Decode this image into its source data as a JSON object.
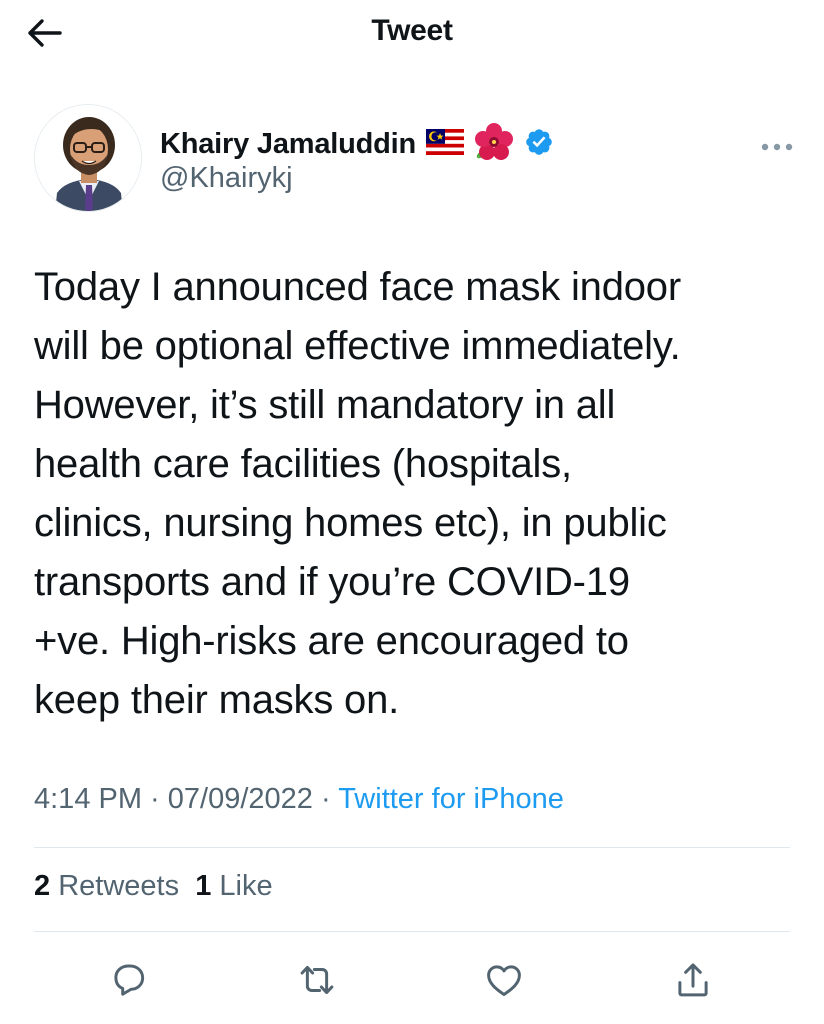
{
  "header": {
    "back_icon": "arrow-left-icon",
    "title": "Tweet"
  },
  "author": {
    "name": "Khairy Jamaluddin",
    "handle": "@Khairykj",
    "badges": [
      "malaysia-flag-icon",
      "hibiscus-icon",
      "verified-badge-icon"
    ],
    "verified_color": "#1d9bf0"
  },
  "tweet": {
    "text": "Today I announced face mask indoor\nwill be optional effective immediately.\nHowever, it’s still mandatory in all\nhealth care facilities (hospitals,\nclinics, nursing homes etc), in public\ntransports and if you’re COVID-19\n+ve. High-risks are encouraged to\nkeep their masks on.",
    "time": "4:14 PM",
    "separator": " · ",
    "date": "07/09/2022",
    "source": "Twitter for iPhone"
  },
  "stats": {
    "retweets_count": "2",
    "retweets_label": "Retweets",
    "likes_count": "1",
    "likes_label": "Like"
  },
  "actions": [
    "reply-icon",
    "retweet-icon",
    "like-icon",
    "share-icon"
  ],
  "colors": {
    "text": "#0f1419",
    "secondary": "#536471",
    "link": "#1d9bf0",
    "divider": "#e1e8ed"
  }
}
